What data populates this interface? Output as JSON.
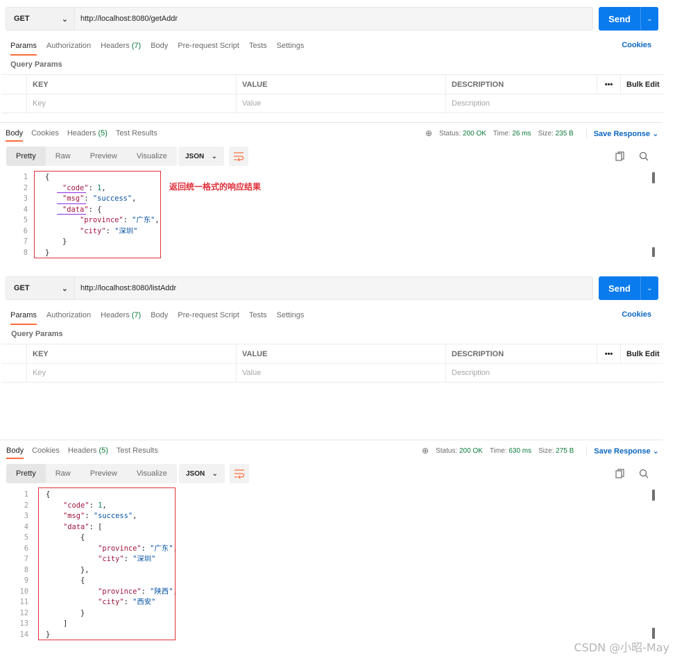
{
  "request1": {
    "method": "GET",
    "url": "http://localhost:8080/getAddr",
    "send_label": "Send",
    "tabs": [
      {
        "label": "Params",
        "count": ""
      },
      {
        "label": "Authorization",
        "count": ""
      },
      {
        "label": "Headers",
        "count": "(7)"
      },
      {
        "label": "Body",
        "count": ""
      },
      {
        "label": "Pre-request Script",
        "count": ""
      },
      {
        "label": "Tests",
        "count": ""
      },
      {
        "label": "Settings",
        "count": ""
      }
    ],
    "cookies_label": "Cookies",
    "query_params_label": "Query Params",
    "table_headers": {
      "key": "KEY",
      "value": "VALUE",
      "description": "DESCRIPTION",
      "more": "•••",
      "bulk_edit": "Bulk Edit"
    },
    "placeholders": {
      "key": "Key",
      "value": "Value",
      "description": "Description"
    }
  },
  "response1": {
    "tabs": [
      {
        "label": "Body",
        "count": ""
      },
      {
        "label": "Cookies",
        "count": ""
      },
      {
        "label": "Headers",
        "count": "(5)"
      },
      {
        "label": "Test Results",
        "count": ""
      }
    ],
    "status_label": "Status:",
    "status_value": "200 OK",
    "time_label": "Time:",
    "time_value": "26 ms",
    "size_label": "Size:",
    "size_value": "235 B",
    "save_response": "Save Response",
    "view_modes": [
      "Pretty",
      "Raw",
      "Preview",
      "Visualize"
    ],
    "format": "JSON",
    "annotation": "返回统一格式的响应结果",
    "lines": [
      [
        {
          "t": "{",
          "c": "p"
        }
      ],
      [
        {
          "t": "    ",
          "c": "p"
        },
        {
          "t": "\"code\"",
          "c": "k"
        },
        {
          "t": ": ",
          "c": "p"
        },
        {
          "t": "1",
          "c": "n"
        },
        {
          "t": ",",
          "c": "p"
        }
      ],
      [
        {
          "t": "    ",
          "c": "p"
        },
        {
          "t": "\"msg\"",
          "c": "k"
        },
        {
          "t": ": ",
          "c": "p"
        },
        {
          "t": "\"success\"",
          "c": "s"
        },
        {
          "t": ",",
          "c": "p"
        }
      ],
      [
        {
          "t": "    ",
          "c": "p"
        },
        {
          "t": "\"data\"",
          "c": "k"
        },
        {
          "t": ": {",
          "c": "p"
        }
      ],
      [
        {
          "t": "        ",
          "c": "p"
        },
        {
          "t": "\"province\"",
          "c": "k"
        },
        {
          "t": ": ",
          "c": "p"
        },
        {
          "t": "\"广东\"",
          "c": "s"
        },
        {
          "t": ",",
          "c": "p"
        }
      ],
      [
        {
          "t": "        ",
          "c": "p"
        },
        {
          "t": "\"city\"",
          "c": "k"
        },
        {
          "t": ": ",
          "c": "p"
        },
        {
          "t": "\"深圳\"",
          "c": "s"
        }
      ],
      [
        {
          "t": "    }",
          "c": "p"
        }
      ],
      [
        {
          "t": "}",
          "c": "p"
        }
      ]
    ]
  },
  "request2": {
    "method": "GET",
    "url": "http://localhost:8080/listAddr",
    "send_label": "Send",
    "tabs": [
      {
        "label": "Params",
        "count": ""
      },
      {
        "label": "Authorization",
        "count": ""
      },
      {
        "label": "Headers",
        "count": "(7)"
      },
      {
        "label": "Body",
        "count": ""
      },
      {
        "label": "Pre-request Script",
        "count": ""
      },
      {
        "label": "Tests",
        "count": ""
      },
      {
        "label": "Settings",
        "count": ""
      }
    ],
    "cookies_label": "Cookies",
    "query_params_label": "Query Params",
    "table_headers": {
      "key": "KEY",
      "value": "VALUE",
      "description": "DESCRIPTION",
      "more": "•••",
      "bulk_edit": "Bulk Edit"
    },
    "placeholders": {
      "key": "Key",
      "value": "Value",
      "description": "Description"
    }
  },
  "response2": {
    "tabs": [
      {
        "label": "Body",
        "count": ""
      },
      {
        "label": "Cookies",
        "count": ""
      },
      {
        "label": "Headers",
        "count": "(5)"
      },
      {
        "label": "Test Results",
        "count": ""
      }
    ],
    "status_label": "Status:",
    "status_value": "200 OK",
    "time_label": "Time:",
    "time_value": "630 ms",
    "size_label": "Size:",
    "size_value": "275 B",
    "save_response": "Save Response",
    "view_modes": [
      "Pretty",
      "Raw",
      "Preview",
      "Visualize"
    ],
    "format": "JSON",
    "lines": [
      [
        {
          "t": "{",
          "c": "p"
        }
      ],
      [
        {
          "t": "    ",
          "c": "p"
        },
        {
          "t": "\"code\"",
          "c": "k"
        },
        {
          "t": ": ",
          "c": "p"
        },
        {
          "t": "1",
          "c": "n"
        },
        {
          "t": ",",
          "c": "p"
        }
      ],
      [
        {
          "t": "    ",
          "c": "p"
        },
        {
          "t": "\"msg\"",
          "c": "k"
        },
        {
          "t": ": ",
          "c": "p"
        },
        {
          "t": "\"success\"",
          "c": "s"
        },
        {
          "t": ",",
          "c": "p"
        }
      ],
      [
        {
          "t": "    ",
          "c": "p"
        },
        {
          "t": "\"data\"",
          "c": "k"
        },
        {
          "t": ": [",
          "c": "p"
        }
      ],
      [
        {
          "t": "        {",
          "c": "p"
        }
      ],
      [
        {
          "t": "            ",
          "c": "p"
        },
        {
          "t": "\"province\"",
          "c": "k"
        },
        {
          "t": ": ",
          "c": "p"
        },
        {
          "t": "\"广东\"",
          "c": "s"
        },
        {
          "t": ",",
          "c": "p"
        }
      ],
      [
        {
          "t": "            ",
          "c": "p"
        },
        {
          "t": "\"city\"",
          "c": "k"
        },
        {
          "t": ": ",
          "c": "p"
        },
        {
          "t": "\"深圳\"",
          "c": "s"
        }
      ],
      [
        {
          "t": "        },",
          "c": "p"
        }
      ],
      [
        {
          "t": "        {",
          "c": "p"
        }
      ],
      [
        {
          "t": "            ",
          "c": "p"
        },
        {
          "t": "\"province\"",
          "c": "k"
        },
        {
          "t": ": ",
          "c": "p"
        },
        {
          "t": "\"陕西\"",
          "c": "s"
        },
        {
          "t": ",",
          "c": "p"
        }
      ],
      [
        {
          "t": "            ",
          "c": "p"
        },
        {
          "t": "\"city\"",
          "c": "k"
        },
        {
          "t": ": ",
          "c": "p"
        },
        {
          "t": "\"西安\"",
          "c": "s"
        }
      ],
      [
        {
          "t": "        }",
          "c": "p"
        }
      ],
      [
        {
          "t": "    ]",
          "c": "p"
        }
      ],
      [
        {
          "t": "}",
          "c": "p"
        }
      ]
    ]
  },
  "watermark": "CSDN @小昭-May",
  "colors": {
    "accent": "#097bed",
    "active_tab": "#ff6c37",
    "status_ok": "#0a7a3b",
    "link": "#0b66c2",
    "annotation": "#e0303a"
  }
}
